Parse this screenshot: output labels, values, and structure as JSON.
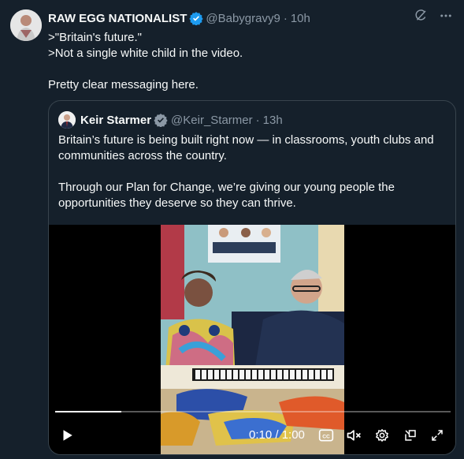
{
  "author": {
    "name": "RAW EGG NATIONALIST",
    "handle": "@Babygravy9",
    "time": "10h"
  },
  "tweet": {
    "text": ">\"Britain's future.\"\n>Not a single white child in the video.\n\nPretty clear messaging here."
  },
  "quote": {
    "name": "Keir Starmer",
    "handle": "@Keir_Starmer",
    "time": "13h",
    "text": "Britain’s future is being built right now — in classrooms, youth clubs and communities across the country.\n\nThrough our Plan for Change, we’re giving our young people the opportunities they deserve so they can thrive."
  },
  "video": {
    "timecode": "0:10 / 1:00",
    "progress": 0.167
  },
  "icons": {
    "verified": "verified-badge-icon",
    "grok": "grok-icon",
    "more": "more-icon",
    "play": "play-icon",
    "captions": "captions-icon",
    "mute": "mute-icon",
    "settings": "settings-icon",
    "popout": "popout-icon",
    "fullscreen": "fullscreen-icon"
  },
  "colors": {
    "background": "#15202b",
    "verified": "#1d9bf0",
    "secondary_text": "#8b98a5",
    "border": "#38444d"
  }
}
